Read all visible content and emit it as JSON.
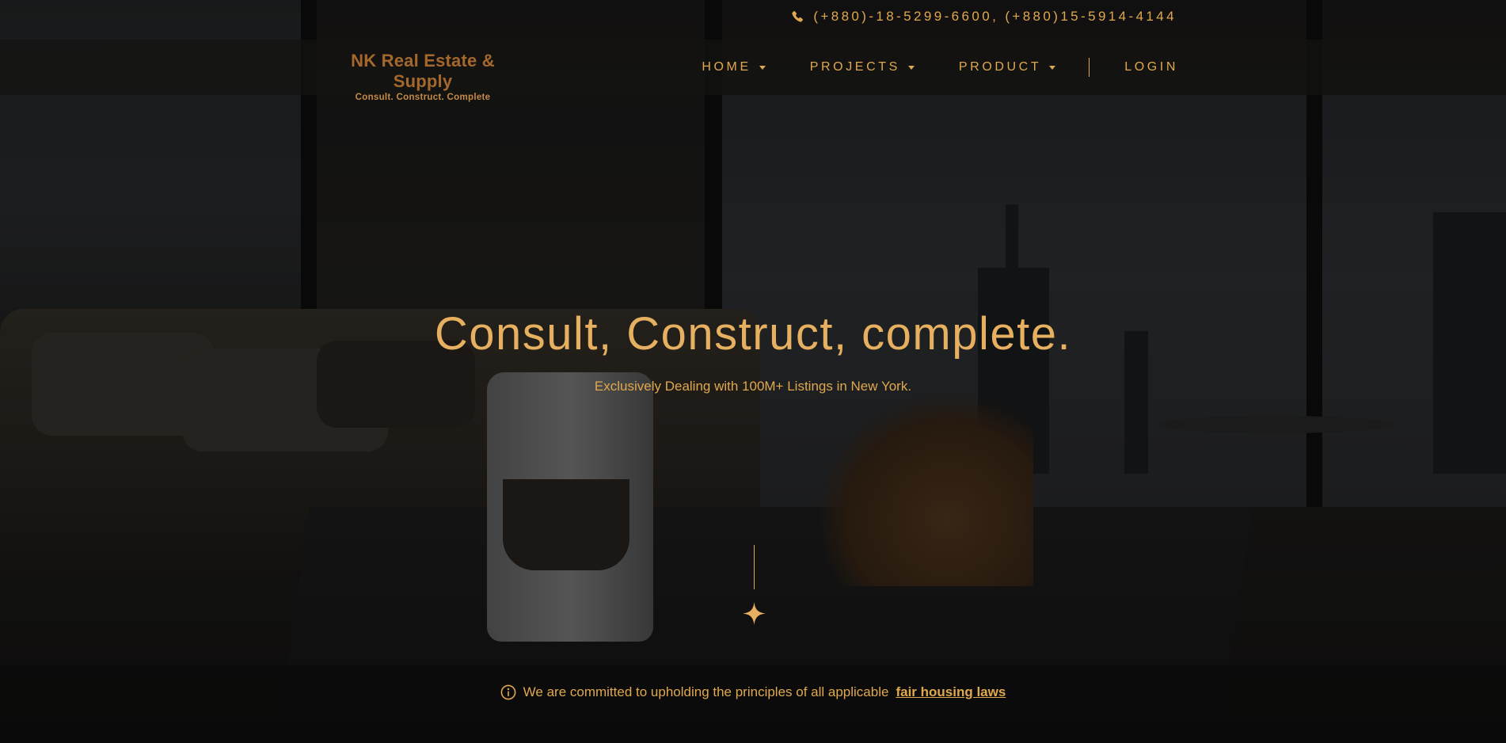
{
  "topbar": {
    "phone_icon": "phone-icon",
    "phone_numbers": "(+880)-18-5299-6600, (+880)15-5914-4144"
  },
  "brand": {
    "title": "NK Real Estate & Supply",
    "tagline": "Consult. Construct. Complete"
  },
  "nav": {
    "home": "HOME",
    "projects": "PROJECTS",
    "product": "PRODUCT",
    "login": "LOGIN",
    "dropdown_icon": "caret-down-icon"
  },
  "hero": {
    "title": "Consult, Construct, complete.",
    "subtitle": "Exclusively Dealing with 100M+ Listings in New York.",
    "scroll_icon": "sparkle-star-icon"
  },
  "notice": {
    "icon": "info-icon",
    "text": "We are committed to upholding the principles of all applicable",
    "link": "fair housing laws"
  },
  "colors": {
    "accent": "#e0a84f",
    "logo": "#a4682c",
    "nav_bg": "#141312",
    "notice_bg": "#0a0a0a"
  }
}
